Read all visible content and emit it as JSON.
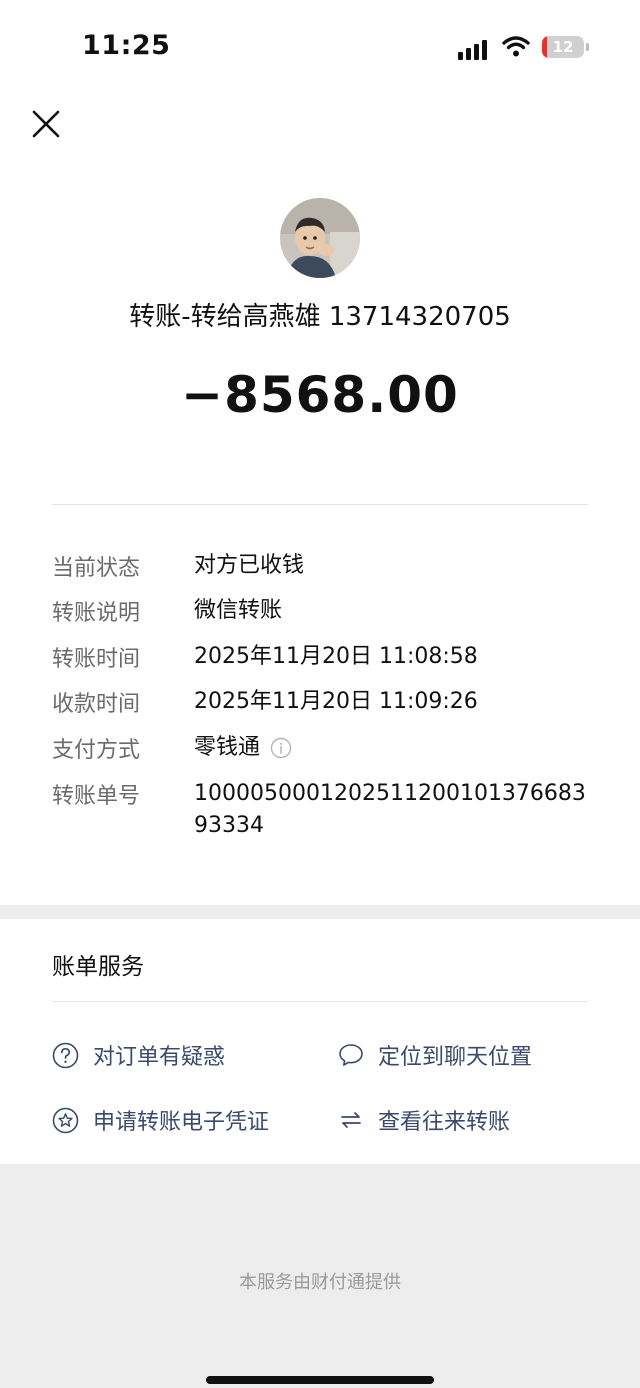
{
  "status_bar": {
    "time": "11:25",
    "battery": "12",
    "battery_color": "#e3342f"
  },
  "header": {
    "close_icon": "close-icon",
    "avatar": "user-avatar"
  },
  "transfer": {
    "title": "转账-转给高燕雄 13714320705",
    "amount": "−8568.00"
  },
  "details": [
    {
      "label": "当前状态",
      "value": "对方已收钱"
    },
    {
      "label": "转账说明",
      "value": "微信转账"
    },
    {
      "label": "转账时间",
      "value": "2025年11月20日 11:08:58"
    },
    {
      "label": "收款时间",
      "value": "2025年11月20日 11:09:26"
    },
    {
      "label": "支付方式",
      "value": "零钱通",
      "icon": "info-icon"
    },
    {
      "label": "转账单号",
      "value": "100005000120251120010137668393334"
    }
  ],
  "services": {
    "title": "账单服务",
    "items": [
      {
        "label": "对订单有疑惑",
        "icon": "question-circle-icon"
      },
      {
        "label": "定位到聊天位置",
        "icon": "chat-bubble-icon"
      },
      {
        "label": "申请转账电子凭证",
        "icon": "star-badge-icon"
      },
      {
        "label": "查看往来转账",
        "icon": "swap-arrows-icon"
      }
    ],
    "link_color": "#3b4a6b"
  },
  "footer": {
    "text": "本服务由财付通提供"
  }
}
